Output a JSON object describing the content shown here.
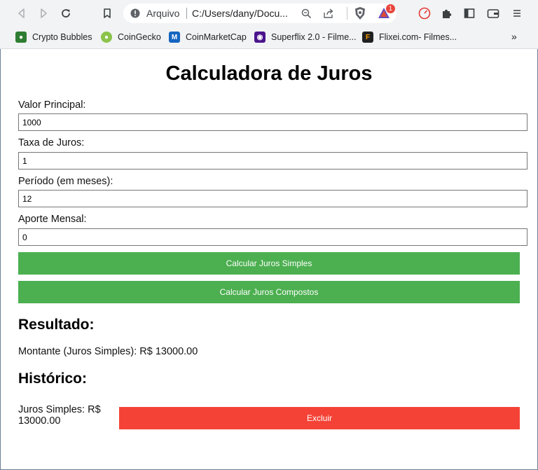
{
  "browser": {
    "url_label": "Arquivo",
    "url_text": "C:/Users/dany/Docu...",
    "bookmarks": [
      {
        "label": "Crypto Bubbles",
        "color": "#2e7d32"
      },
      {
        "label": "CoinGecko",
        "color": "#8bc34a"
      },
      {
        "label": "CoinMarketCap",
        "color": "#1565c0"
      },
      {
        "label": "Superflix 2.0 - Filme...",
        "color": "#4a148c"
      },
      {
        "label": "Flixei.com- Filmes...",
        "color": "#212121"
      }
    ],
    "notification_count": "1"
  },
  "page": {
    "title": "Calculadora de Juros",
    "fields": [
      {
        "label": "Valor Principal:",
        "value": "1000"
      },
      {
        "label": "Taxa de Juros:",
        "value": "1"
      },
      {
        "label": "Período (em meses):",
        "value": "12"
      },
      {
        "label": "Aporte Mensal:",
        "value": "0"
      }
    ],
    "buttons": {
      "simple": "Calcular Juros Simples",
      "compound": "Calcular Juros Compostos"
    },
    "result_heading": "Resultado:",
    "result_text": "Montante (Juros Simples): R$ 13000.00",
    "history_heading": "Histórico:",
    "history": [
      {
        "text": "Juros Simples: R$ 13000.00",
        "delete_label": "Excluir"
      }
    ],
    "colors": {
      "primary_button": "#4caf50",
      "delete_button": "#f44336"
    }
  }
}
